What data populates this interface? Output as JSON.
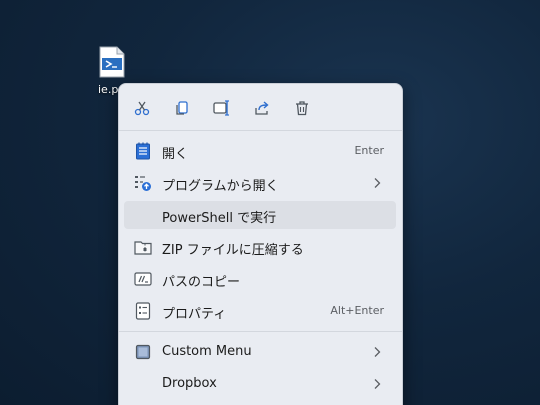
{
  "desktop": {
    "file_label": "ie.p"
  },
  "action_bar": [
    {
      "name": "cut-icon"
    },
    {
      "name": "copy-icon"
    },
    {
      "name": "rename-icon"
    },
    {
      "name": "share-icon"
    },
    {
      "name": "delete-icon"
    }
  ],
  "menu": {
    "open": {
      "label": "開く",
      "shortcut": "Enter",
      "icon": "notepad-icon"
    },
    "open_with": {
      "label": "プログラムから開く",
      "icon": "open-with-icon"
    },
    "run_powershell": {
      "label": "PowerShell で実行"
    },
    "zip": {
      "label": "ZIP ファイルに圧縮する",
      "icon": "zip-folder-icon"
    },
    "copy_path": {
      "label": "パスのコピー",
      "icon": "copy-path-icon"
    },
    "properties": {
      "label": "プロパティ",
      "shortcut": "Alt+Enter",
      "icon": "properties-icon"
    },
    "custom_menu": {
      "label": "Custom Menu",
      "icon": "custom-menu-icon"
    },
    "dropbox": {
      "label": "Dropbox"
    }
  },
  "colors": {
    "menu_bg": "#e9ecf2",
    "accent": "#2b6fd6",
    "desktop_bg": "#11263d"
  }
}
